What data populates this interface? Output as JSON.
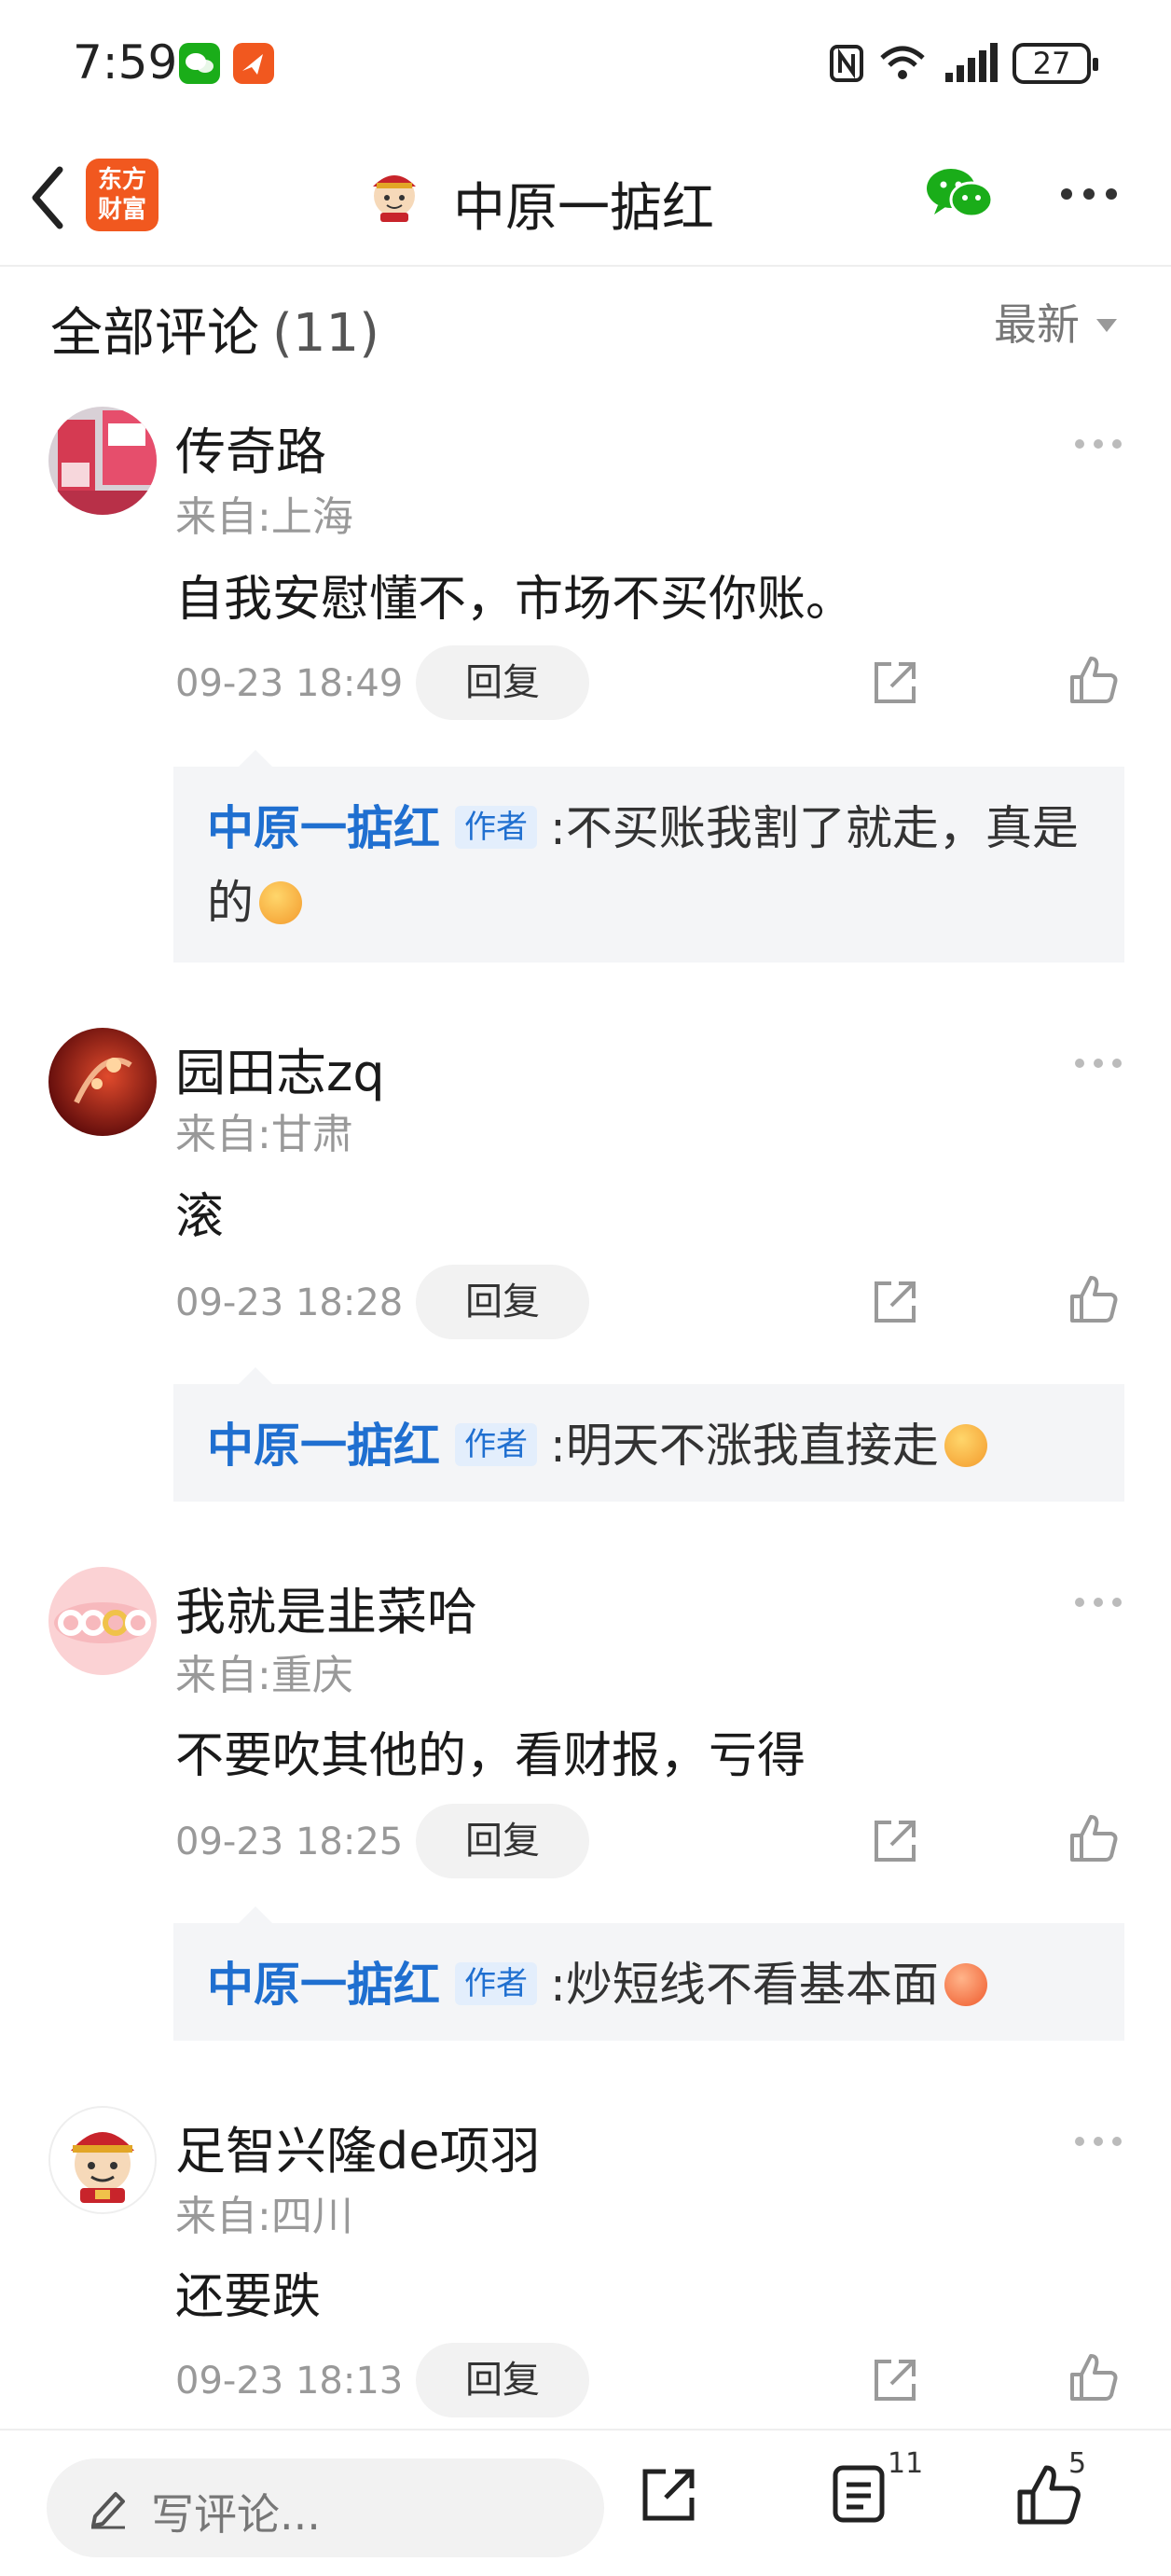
{
  "status_bar": {
    "time": "7:59",
    "battery": "27"
  },
  "nav": {
    "logo_line1": "东方",
    "logo_line2": "财富",
    "title": "中原一掂红"
  },
  "header": {
    "title": "全部评论",
    "count": "(11)",
    "sort_label": "最新"
  },
  "comments": [
    {
      "user": "传奇路",
      "location": "来自:上海",
      "text": "自我安慰懂不，市场不买你账。",
      "time": "09-23 18:49",
      "reply_label": "回复",
      "reply": {
        "author": "中原一掂红",
        "tag": "作者",
        "text": ":不买账我割了就走，真是的"
      }
    },
    {
      "user": "园田志zq",
      "location": "来自:甘肃",
      "text": "滚",
      "time": "09-23 18:28",
      "reply_label": "回复",
      "reply": {
        "author": "中原一掂红",
        "tag": "作者",
        "text": ":明天不涨我直接走"
      }
    },
    {
      "user": "我就是韭菜哈",
      "location": "来自:重庆",
      "text": "不要吹其他的，看财报，亏得",
      "time": "09-23 18:25",
      "reply_label": "回复",
      "reply": {
        "author": "中原一掂红",
        "tag": "作者",
        "text": ":炒短线不看基本面"
      }
    },
    {
      "user": "足智兴隆de项羽",
      "location": "来自:四川",
      "text": "还要跌",
      "time": "09-23 18:13",
      "reply_label": "回复"
    }
  ],
  "bottom_bar": {
    "placeholder": "写评论...",
    "comment_count": "11",
    "like_count": "5"
  },
  "icons": [
    "back-icon",
    "wechat-icon",
    "more-icon",
    "share-icon",
    "like-icon",
    "pencil-icon",
    "comments-icon"
  ],
  "colors": {
    "author_blue": "#1f6fd0",
    "logo_orange": "#f1581f",
    "wechat_green": "#1aad19"
  }
}
